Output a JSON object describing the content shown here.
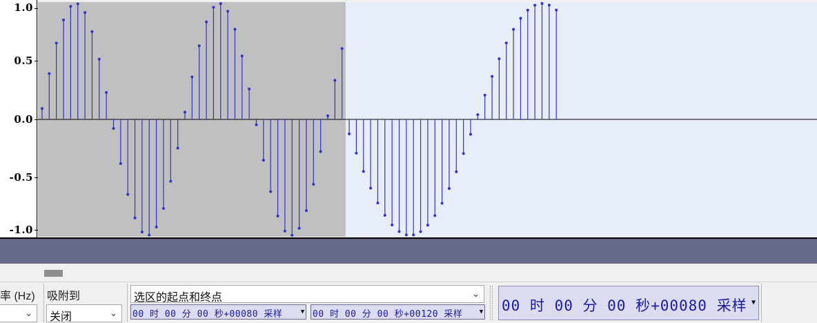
{
  "waveform": {
    "y_axis_labels": [
      "1.0",
      "0.5",
      "0.0",
      "-0.5",
      "-1.0"
    ],
    "selection_start_sample": 80,
    "selection_end_sample": 120,
    "first_visible_sample": 77,
    "last_visible_sample": 137,
    "colors": {
      "selected_bg": "#c0c0c0",
      "unselected_bg": "#e8eef9",
      "stem": "#3232c8",
      "track_footer": "#666a88"
    }
  },
  "toolbar": {
    "rate_label": "率 (Hz)",
    "snap_label": "吸附到",
    "snap_value": "关闭",
    "selection_mode_value": "选区的起点和终点",
    "selection_start_time": "00 时 00 分 00 秒+00080 采样",
    "selection_end_time": "00 时 00 分 00 秒+00120 采样",
    "audio_position_time": "00 时 00 分 00 秒+00080 采样"
  },
  "icons": {
    "dropdown": "chevron-down-icon",
    "time_format_menu": "triangle-down-icon"
  }
}
